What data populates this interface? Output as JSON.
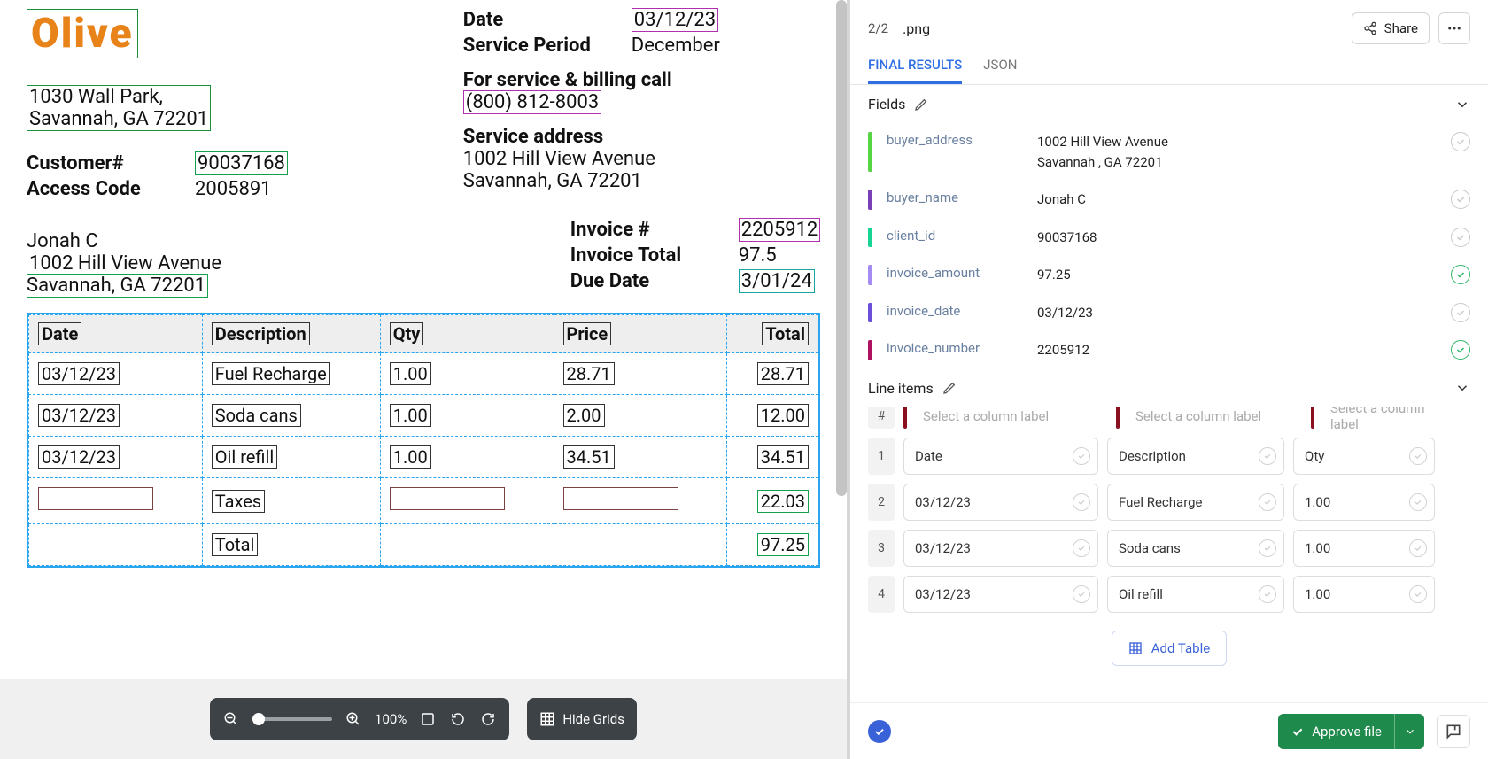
{
  "doc": {
    "logo": "Olive",
    "company_address_l1": "1030 Wall Park,",
    "company_address_l2": "Savannah, GA 72201",
    "date_k": "Date",
    "date_v": "03/12/23",
    "period_k": "Service Period",
    "period_v": "December",
    "svc_call_k": "For service & billing call",
    "svc_call_v": "(800) 812-8003",
    "svc_addr_k": "Service address",
    "svc_addr_l1": "1002 Hill View Avenue",
    "svc_addr_l2": "Savannah, GA 72201",
    "cust_k": "Customer#",
    "cust_v": "90037168",
    "acc_k": "Access Code",
    "acc_v": "2005891",
    "buyer_name": "Jonah C",
    "buyer_l1": "1002 Hill View Avenue",
    "buyer_l2": "Savannah, GA 72201",
    "invno_k": "Invoice #",
    "invno_v": "2205912",
    "invtot_k": "Invoice Total",
    "invtot_v": "97.5",
    "due_k": "Due Date",
    "due_v": "3/01/24",
    "th": {
      "date": "Date",
      "desc": "Description",
      "qty": "Qty",
      "price": "Price",
      "total": "Total"
    },
    "rows": [
      {
        "date": "03/12/23",
        "desc": "Fuel Recharge",
        "qty": "1.00",
        "price": "28.71",
        "total": "28.71"
      },
      {
        "date": "03/12/23",
        "desc": "Soda cans",
        "qty": "1.00",
        "price": "2.00",
        "total": "12.00"
      },
      {
        "date": "03/12/23",
        "desc": "Oil refill",
        "qty": "1.00",
        "price": "34.51",
        "total": "34.51"
      }
    ],
    "taxes_lbl": "Taxes",
    "taxes_v": "22.03",
    "total_lbl": "Total",
    "total_v": "97.25"
  },
  "viewer": {
    "zoom": "100%",
    "hide_grids": "Hide Grids"
  },
  "header": {
    "page": "2/2",
    "filename": ".png",
    "share": "Share"
  },
  "tabs": {
    "results": "FINAL RESULTS",
    "json": "JSON"
  },
  "sections": {
    "fields": "Fields",
    "lineitems": "Line items"
  },
  "fields": [
    {
      "color": "#56d645",
      "key": "buyer_address",
      "value": "1002 Hill View Avenue\nSavannah , GA 72201",
      "ok": false
    },
    {
      "color": "#7b3fb5",
      "key": "buyer_name",
      "value": "Jonah C",
      "ok": false
    },
    {
      "color": "#17d492",
      "key": "client_id",
      "value": "90037168",
      "ok": false
    },
    {
      "color": "#a58cf2",
      "key": "invoice_amount",
      "value": "97.25",
      "ok": true
    },
    {
      "color": "#6b4fd8",
      "key": "invoice_date",
      "value": "03/12/23",
      "ok": false
    },
    {
      "color": "#b01060",
      "key": "invoice_number",
      "value": "2205912",
      "ok": true
    }
  ],
  "lineitems": {
    "num": "#",
    "placeholder": "Select a column label",
    "header_stripes": [
      "#8a1020",
      "#8a1020",
      "#8a1020"
    ],
    "col1": "Date",
    "col2": "Description",
    "col3": "Qty",
    "rows": [
      {
        "n": "1",
        "c1": "Date",
        "c2": "Description",
        "c3": "Qty"
      },
      {
        "n": "2",
        "c1": "03/12/23",
        "c2": "Fuel Recharge",
        "c3": "1.00"
      },
      {
        "n": "3",
        "c1": "03/12/23",
        "c2": "Soda cans",
        "c3": "1.00"
      },
      {
        "n": "4",
        "c1": "03/12/23",
        "c2": "Oil refill",
        "c3": "1.00"
      }
    ],
    "add": "Add Table"
  },
  "footer": {
    "approve": "Approve file"
  }
}
